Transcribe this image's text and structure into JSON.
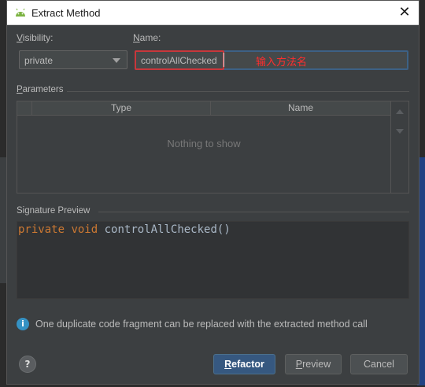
{
  "dialog": {
    "title": "Extract Method",
    "close_glyph": "✕",
    "icon": "android-icon"
  },
  "visibility": {
    "label_mnemonic": "V",
    "label_rest": "isibility:",
    "selected": "private"
  },
  "name": {
    "label_mnemonic": "N",
    "label_rest": "ame:",
    "value": "controlAllChecked",
    "annotation": "输入方法名"
  },
  "parameters": {
    "label_mnemonic": "P",
    "label_rest": "arameters",
    "columns": [
      "Type",
      "Name"
    ],
    "empty_text": "Nothing to show"
  },
  "signature": {
    "label": "Signature Preview",
    "keyword1": "private",
    "keyword2": "void",
    "method": "controlAllChecked()"
  },
  "info": {
    "icon": "info-icon",
    "text": "One duplicate code fragment can be replaced with the extracted method call"
  },
  "buttons": {
    "help": "?",
    "refactor_mnemonic": "R",
    "refactor_rest": "efactor",
    "preview_mnemonic": "P",
    "preview_rest": "review",
    "cancel": "Cancel"
  },
  "colors": {
    "dialog_bg": "#3c3f41",
    "accent": "#365880",
    "keyword": "#cc7832",
    "annotation": "#ff2e2e",
    "highlight_border": "#c8373b"
  }
}
